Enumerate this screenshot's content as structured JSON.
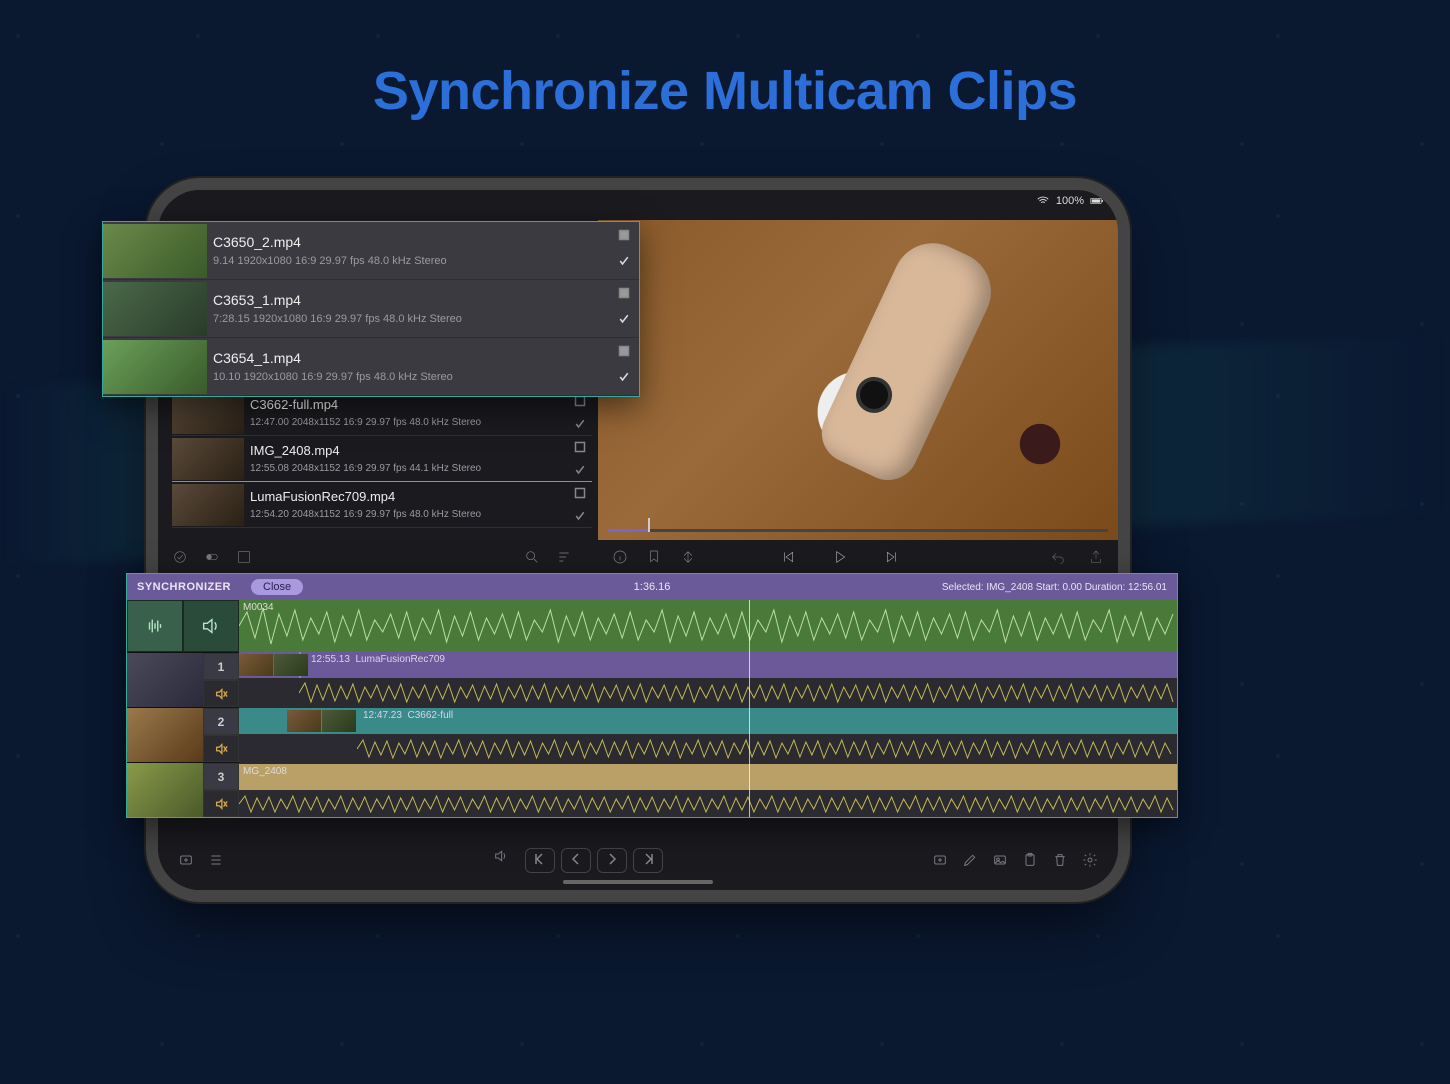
{
  "headline": "Synchronize Multicam Clips",
  "status": {
    "battery": "100%"
  },
  "popup_clips": [
    {
      "name": "C3650_2.mp4",
      "meta": "9.14  1920x1080  16:9  29.97 fps  48.0 kHz  Stereo",
      "checked": true
    },
    {
      "name": "C3653_1.mp4",
      "meta": "7:28.15  1920x1080  16:9  29.97 fps  48.0 kHz  Stereo",
      "checked": true
    },
    {
      "name": "C3654_1.mp4",
      "meta": "10.10  1920x1080  16:9  29.97 fps  48.0 kHz  Stereo",
      "checked": true
    }
  ],
  "lower_clips": [
    {
      "name": "C3662-full.mp4",
      "meta": "12:47.00  2048x1152  16:9  29.97 fps  48.0 kHz  Stereo"
    },
    {
      "name": "IMG_2408.mp4",
      "meta": "12:55.08  2048x1152  16:9  29.97 fps  44.1 kHz  Stereo"
    },
    {
      "name": "LumaFusionRec709.mp4",
      "meta": "12:54.20  2048x1152  16:9  29.97 fps  48.0 kHz  Stereo"
    }
  ],
  "sync": {
    "title": "SYNCHRONIZER",
    "close": "Close",
    "timecode": "1:36.16",
    "selected": "Selected: IMG_2408 Start: 0.00 Duration: 12:56.01",
    "track_green_label": "M0034",
    "track_purple_time": "12:55.13",
    "track_purple_name": "LumaFusionRec709",
    "track_teal_time": "12:47.23",
    "track_teal_name": "C3662-full",
    "track_tan_name": "MG_2408",
    "track_numbers": [
      "1",
      "2",
      "3"
    ]
  }
}
